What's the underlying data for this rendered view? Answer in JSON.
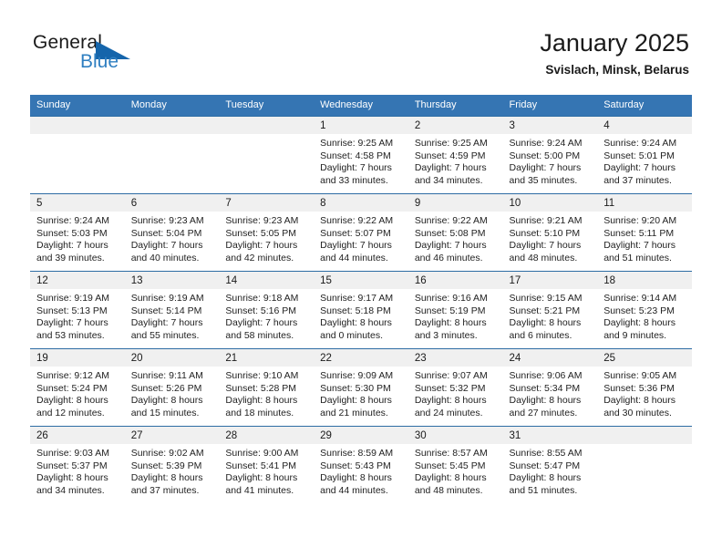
{
  "brand": {
    "name_part1": "General",
    "name_part2": "Blue",
    "logo_icon": "triangle-flag-icon",
    "accent_color": "#2f7fc1"
  },
  "header": {
    "title": "January 2025",
    "location": "Svislach, Minsk, Belarus"
  },
  "theme": {
    "header_bg": "#3575b3",
    "daynum_bg": "#f0f0f0",
    "row_border": "#2e6da4"
  },
  "weekdays": [
    "Sunday",
    "Monday",
    "Tuesday",
    "Wednesday",
    "Thursday",
    "Friday",
    "Saturday"
  ],
  "weeks": [
    [
      {
        "day": "",
        "empty": true,
        "sunrise": "",
        "sunset": "",
        "daylight1": "",
        "daylight2": ""
      },
      {
        "day": "",
        "empty": true,
        "sunrise": "",
        "sunset": "",
        "daylight1": "",
        "daylight2": ""
      },
      {
        "day": "",
        "empty": true,
        "sunrise": "",
        "sunset": "",
        "daylight1": "",
        "daylight2": ""
      },
      {
        "day": "1",
        "empty": false,
        "sunrise": "Sunrise: 9:25 AM",
        "sunset": "Sunset: 4:58 PM",
        "daylight1": "Daylight: 7 hours",
        "daylight2": "and 33 minutes."
      },
      {
        "day": "2",
        "empty": false,
        "sunrise": "Sunrise: 9:25 AM",
        "sunset": "Sunset: 4:59 PM",
        "daylight1": "Daylight: 7 hours",
        "daylight2": "and 34 minutes."
      },
      {
        "day": "3",
        "empty": false,
        "sunrise": "Sunrise: 9:24 AM",
        "sunset": "Sunset: 5:00 PM",
        "daylight1": "Daylight: 7 hours",
        "daylight2": "and 35 minutes."
      },
      {
        "day": "4",
        "empty": false,
        "sunrise": "Sunrise: 9:24 AM",
        "sunset": "Sunset: 5:01 PM",
        "daylight1": "Daylight: 7 hours",
        "daylight2": "and 37 minutes."
      }
    ],
    [
      {
        "day": "5",
        "empty": false,
        "sunrise": "Sunrise: 9:24 AM",
        "sunset": "Sunset: 5:03 PM",
        "daylight1": "Daylight: 7 hours",
        "daylight2": "and 39 minutes."
      },
      {
        "day": "6",
        "empty": false,
        "sunrise": "Sunrise: 9:23 AM",
        "sunset": "Sunset: 5:04 PM",
        "daylight1": "Daylight: 7 hours",
        "daylight2": "and 40 minutes."
      },
      {
        "day": "7",
        "empty": false,
        "sunrise": "Sunrise: 9:23 AM",
        "sunset": "Sunset: 5:05 PM",
        "daylight1": "Daylight: 7 hours",
        "daylight2": "and 42 minutes."
      },
      {
        "day": "8",
        "empty": false,
        "sunrise": "Sunrise: 9:22 AM",
        "sunset": "Sunset: 5:07 PM",
        "daylight1": "Daylight: 7 hours",
        "daylight2": "and 44 minutes."
      },
      {
        "day": "9",
        "empty": false,
        "sunrise": "Sunrise: 9:22 AM",
        "sunset": "Sunset: 5:08 PM",
        "daylight1": "Daylight: 7 hours",
        "daylight2": "and 46 minutes."
      },
      {
        "day": "10",
        "empty": false,
        "sunrise": "Sunrise: 9:21 AM",
        "sunset": "Sunset: 5:10 PM",
        "daylight1": "Daylight: 7 hours",
        "daylight2": "and 48 minutes."
      },
      {
        "day": "11",
        "empty": false,
        "sunrise": "Sunrise: 9:20 AM",
        "sunset": "Sunset: 5:11 PM",
        "daylight1": "Daylight: 7 hours",
        "daylight2": "and 51 minutes."
      }
    ],
    [
      {
        "day": "12",
        "empty": false,
        "sunrise": "Sunrise: 9:19 AM",
        "sunset": "Sunset: 5:13 PM",
        "daylight1": "Daylight: 7 hours",
        "daylight2": "and 53 minutes."
      },
      {
        "day": "13",
        "empty": false,
        "sunrise": "Sunrise: 9:19 AM",
        "sunset": "Sunset: 5:14 PM",
        "daylight1": "Daylight: 7 hours",
        "daylight2": "and 55 minutes."
      },
      {
        "day": "14",
        "empty": false,
        "sunrise": "Sunrise: 9:18 AM",
        "sunset": "Sunset: 5:16 PM",
        "daylight1": "Daylight: 7 hours",
        "daylight2": "and 58 minutes."
      },
      {
        "day": "15",
        "empty": false,
        "sunrise": "Sunrise: 9:17 AM",
        "sunset": "Sunset: 5:18 PM",
        "daylight1": "Daylight: 8 hours",
        "daylight2": "and 0 minutes."
      },
      {
        "day": "16",
        "empty": false,
        "sunrise": "Sunrise: 9:16 AM",
        "sunset": "Sunset: 5:19 PM",
        "daylight1": "Daylight: 8 hours",
        "daylight2": "and 3 minutes."
      },
      {
        "day": "17",
        "empty": false,
        "sunrise": "Sunrise: 9:15 AM",
        "sunset": "Sunset: 5:21 PM",
        "daylight1": "Daylight: 8 hours",
        "daylight2": "and 6 minutes."
      },
      {
        "day": "18",
        "empty": false,
        "sunrise": "Sunrise: 9:14 AM",
        "sunset": "Sunset: 5:23 PM",
        "daylight1": "Daylight: 8 hours",
        "daylight2": "and 9 minutes."
      }
    ],
    [
      {
        "day": "19",
        "empty": false,
        "sunrise": "Sunrise: 9:12 AM",
        "sunset": "Sunset: 5:24 PM",
        "daylight1": "Daylight: 8 hours",
        "daylight2": "and 12 minutes."
      },
      {
        "day": "20",
        "empty": false,
        "sunrise": "Sunrise: 9:11 AM",
        "sunset": "Sunset: 5:26 PM",
        "daylight1": "Daylight: 8 hours",
        "daylight2": "and 15 minutes."
      },
      {
        "day": "21",
        "empty": false,
        "sunrise": "Sunrise: 9:10 AM",
        "sunset": "Sunset: 5:28 PM",
        "daylight1": "Daylight: 8 hours",
        "daylight2": "and 18 minutes."
      },
      {
        "day": "22",
        "empty": false,
        "sunrise": "Sunrise: 9:09 AM",
        "sunset": "Sunset: 5:30 PM",
        "daylight1": "Daylight: 8 hours",
        "daylight2": "and 21 minutes."
      },
      {
        "day": "23",
        "empty": false,
        "sunrise": "Sunrise: 9:07 AM",
        "sunset": "Sunset: 5:32 PM",
        "daylight1": "Daylight: 8 hours",
        "daylight2": "and 24 minutes."
      },
      {
        "day": "24",
        "empty": false,
        "sunrise": "Sunrise: 9:06 AM",
        "sunset": "Sunset: 5:34 PM",
        "daylight1": "Daylight: 8 hours",
        "daylight2": "and 27 minutes."
      },
      {
        "day": "25",
        "empty": false,
        "sunrise": "Sunrise: 9:05 AM",
        "sunset": "Sunset: 5:36 PM",
        "daylight1": "Daylight: 8 hours",
        "daylight2": "and 30 minutes."
      }
    ],
    [
      {
        "day": "26",
        "empty": false,
        "sunrise": "Sunrise: 9:03 AM",
        "sunset": "Sunset: 5:37 PM",
        "daylight1": "Daylight: 8 hours",
        "daylight2": "and 34 minutes."
      },
      {
        "day": "27",
        "empty": false,
        "sunrise": "Sunrise: 9:02 AM",
        "sunset": "Sunset: 5:39 PM",
        "daylight1": "Daylight: 8 hours",
        "daylight2": "and 37 minutes."
      },
      {
        "day": "28",
        "empty": false,
        "sunrise": "Sunrise: 9:00 AM",
        "sunset": "Sunset: 5:41 PM",
        "daylight1": "Daylight: 8 hours",
        "daylight2": "and 41 minutes."
      },
      {
        "day": "29",
        "empty": false,
        "sunrise": "Sunrise: 8:59 AM",
        "sunset": "Sunset: 5:43 PM",
        "daylight1": "Daylight: 8 hours",
        "daylight2": "and 44 minutes."
      },
      {
        "day": "30",
        "empty": false,
        "sunrise": "Sunrise: 8:57 AM",
        "sunset": "Sunset: 5:45 PM",
        "daylight1": "Daylight: 8 hours",
        "daylight2": "and 48 minutes."
      },
      {
        "day": "31",
        "empty": false,
        "sunrise": "Sunrise: 8:55 AM",
        "sunset": "Sunset: 5:47 PM",
        "daylight1": "Daylight: 8 hours",
        "daylight2": "and 51 minutes."
      },
      {
        "day": "",
        "empty": true,
        "sunrise": "",
        "sunset": "",
        "daylight1": "",
        "daylight2": ""
      }
    ]
  ]
}
